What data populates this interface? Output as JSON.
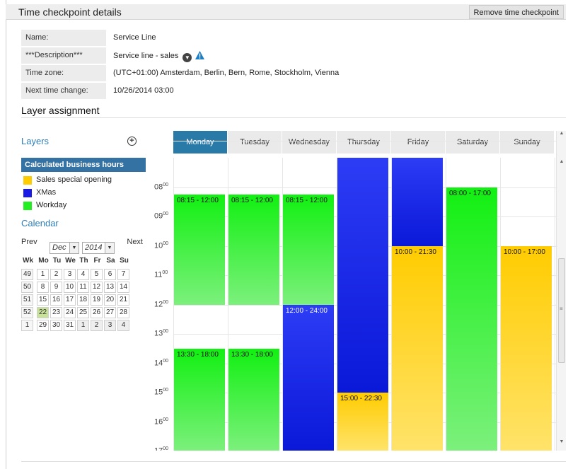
{
  "header": {
    "title": "Time checkpoint details",
    "remove_button": "Remove time checkpoint"
  },
  "properties": [
    {
      "label": "Name:",
      "value": "Service Line"
    },
    {
      "label": "***Description***",
      "value": "Service line - sales"
    },
    {
      "label": "Time zone:",
      "value": "(UTC+01:00) Amsterdam, Berlin, Bern, Rome, Stockholm, Vienna"
    },
    {
      "label": "Next time change:",
      "value": "10/26/2014 03:00"
    }
  ],
  "layer_assignment": {
    "title": "Layer assignment",
    "layers_heading": "Layers",
    "calculated_label": "Calculated business hours",
    "legend": [
      {
        "label": "Sales special opening",
        "color": "#ffcc00"
      },
      {
        "label": "XMas",
        "color": "#1a1ae6"
      },
      {
        "label": "Workday",
        "color": "#22ee22"
      }
    ]
  },
  "calendar": {
    "heading": "Calendar",
    "prev": "Prev",
    "next": "Next",
    "month": "Dec",
    "year": "2014",
    "headers": [
      "Wk",
      "Mo",
      "Tu",
      "We",
      "Th",
      "Fr",
      "Sa",
      "Su"
    ],
    "weeks": [
      [
        "49",
        "1",
        "2",
        "3",
        "4",
        "5",
        "6",
        "7"
      ],
      [
        "50",
        "8",
        "9",
        "10",
        "11",
        "12",
        "13",
        "14"
      ],
      [
        "51",
        "15",
        "16",
        "17",
        "18",
        "19",
        "20",
        "21"
      ],
      [
        "52",
        "22",
        "23",
        "24",
        "25",
        "26",
        "27",
        "28"
      ],
      [
        "1",
        "29",
        "30",
        "31",
        "1",
        "2",
        "3",
        "4"
      ]
    ],
    "today": "22"
  },
  "schedule": {
    "days": [
      "Monday",
      "Tuesday",
      "Wednesday",
      "Thursday",
      "Friday",
      "Saturday",
      "Sunday"
    ],
    "active_day": "Monday",
    "hours": [
      "08",
      "09",
      "10",
      "11",
      "12",
      "13",
      "14",
      "15",
      "16",
      "17"
    ],
    "minutes_label": "00",
    "blocks": [
      {
        "day": 0,
        "label": "08:15 - 12:00",
        "start": 8.25,
        "end": 12.0,
        "type": "green"
      },
      {
        "day": 0,
        "label": "13:30 - 18:00",
        "start": 13.5,
        "end": 18.0,
        "type": "green"
      },
      {
        "day": 1,
        "label": "08:15 - 12:00",
        "start": 8.25,
        "end": 12.0,
        "type": "green"
      },
      {
        "day": 1,
        "label": "13:30 - 18:00",
        "start": 13.5,
        "end": 18.0,
        "type": "green"
      },
      {
        "day": 2,
        "label": "08:15 - 12:00",
        "start": 8.25,
        "end": 12.0,
        "type": "green"
      },
      {
        "day": 2,
        "label": "12:00 - 24:00",
        "start": 12.0,
        "end": 18.0,
        "type": "blue"
      },
      {
        "day": 3,
        "label": "",
        "start": 7.0,
        "end": 15.0,
        "type": "blue"
      },
      {
        "day": 3,
        "label": "15:00 - 22:30",
        "start": 15.0,
        "end": 18.0,
        "type": "yellow"
      },
      {
        "day": 4,
        "label": "",
        "start": 7.0,
        "end": 10.0,
        "type": "blue"
      },
      {
        "day": 4,
        "label": "10:00 - 21:30",
        "start": 10.0,
        "end": 18.0,
        "type": "yellow"
      },
      {
        "day": 5,
        "label": "08:00 - 17:00",
        "start": 8.0,
        "end": 17.0,
        "type": "green"
      },
      {
        "day": 6,
        "label": "10:00 - 17:00",
        "start": 10.0,
        "end": 17.0,
        "type": "yellow"
      }
    ]
  }
}
